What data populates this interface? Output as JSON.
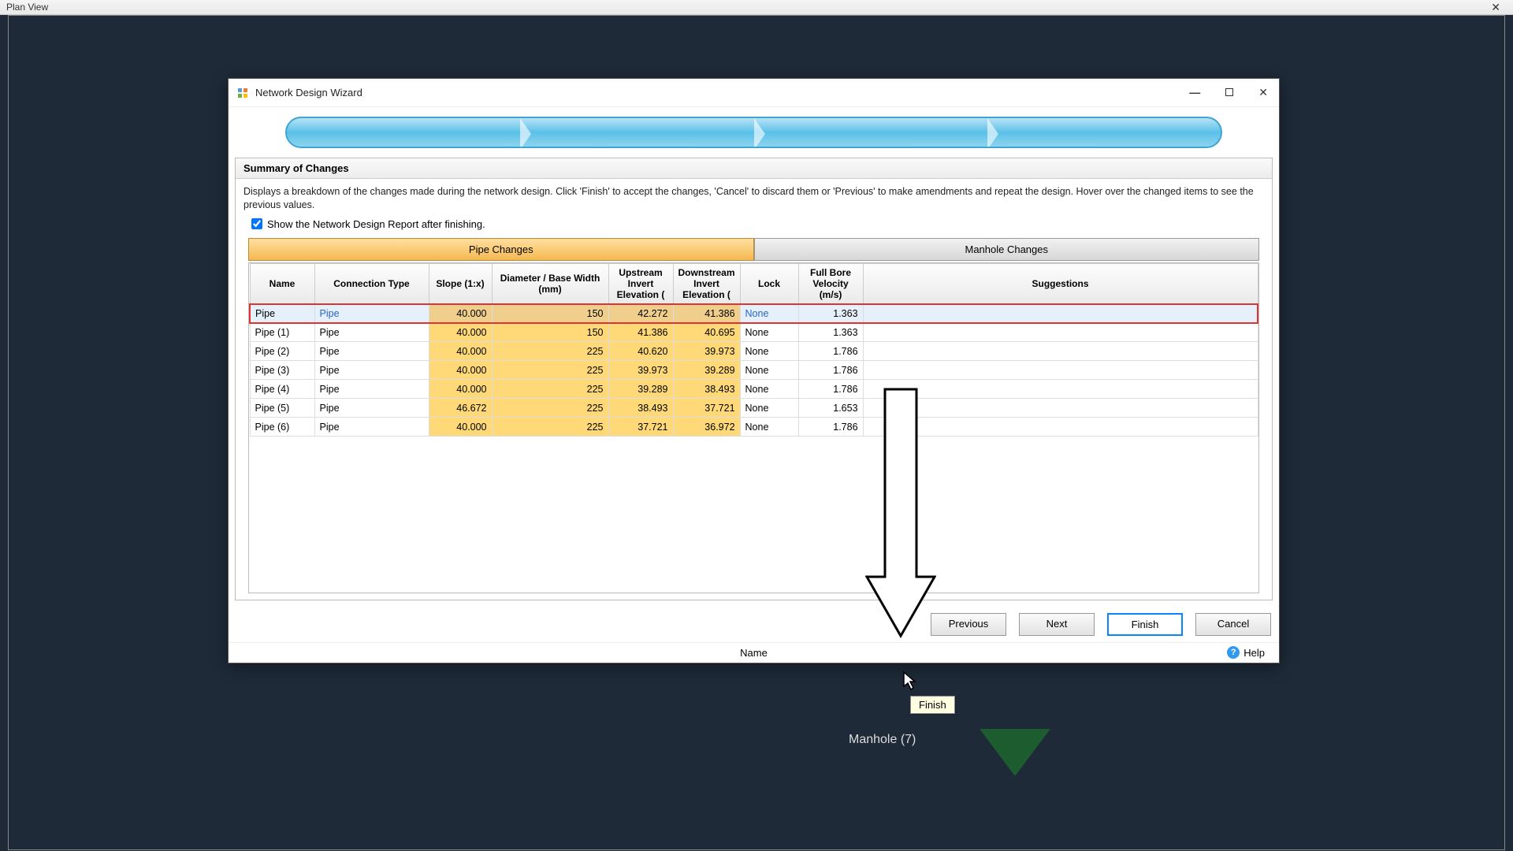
{
  "outer_window": {
    "title": "Plan View"
  },
  "dialog": {
    "title": "Network Design Wizard",
    "section_title": "Summary of Changes",
    "description": "Displays a breakdown of the changes made during the network design. Click 'Finish' to accept the changes, 'Cancel' to discard them or 'Previous' to make amendments and repeat the design. Hover over the changed items to see the previous values.",
    "checkbox_label": "Show the Network Design Report after finishing.",
    "checkbox_checked": true,
    "tabs": {
      "pipe": "Pipe Changes",
      "manhole": "Manhole Changes"
    },
    "headers": {
      "name": "Name",
      "conn": "Connection Type",
      "slope": "Slope (1:x)",
      "diam": "Diameter / Base Width (mm)",
      "up": "Upstream Invert Elevation (",
      "down": "Downstream Invert Elevation (",
      "lock": "Lock",
      "vel": "Full Bore Velocity (m/s)",
      "sugg": "Suggestions"
    },
    "rows": [
      {
        "name": "Pipe",
        "conn": "Pipe",
        "slope": "40.000",
        "diam": "150",
        "up": "42.272",
        "down": "41.386",
        "lock": "None",
        "vel": "1.363",
        "selected": true
      },
      {
        "name": "Pipe (1)",
        "conn": "Pipe",
        "slope": "40.000",
        "diam": "150",
        "up": "41.386",
        "down": "40.695",
        "lock": "None",
        "vel": "1.363"
      },
      {
        "name": "Pipe (2)",
        "conn": "Pipe",
        "slope": "40.000",
        "diam": "225",
        "up": "40.620",
        "down": "39.973",
        "lock": "None",
        "vel": "1.786"
      },
      {
        "name": "Pipe (3)",
        "conn": "Pipe",
        "slope": "40.000",
        "diam": "225",
        "up": "39.973",
        "down": "39.289",
        "lock": "None",
        "vel": "1.786"
      },
      {
        "name": "Pipe (4)",
        "conn": "Pipe",
        "slope": "40.000",
        "diam": "225",
        "up": "39.289",
        "down": "38.493",
        "lock": "None",
        "vel": "1.786"
      },
      {
        "name": "Pipe (5)",
        "conn": "Pipe",
        "slope": "46.672",
        "diam": "225",
        "up": "38.493",
        "down": "37.721",
        "lock": "None",
        "vel": "1.653"
      },
      {
        "name": "Pipe (6)",
        "conn": "Pipe",
        "slope": "40.000",
        "diam": "225",
        "up": "37.721",
        "down": "36.972",
        "lock": "None",
        "vel": "1.786"
      }
    ],
    "buttons": {
      "previous": "Previous",
      "next": "Next",
      "finish": "Finish",
      "cancel": "Cancel"
    },
    "footer": {
      "name_label": "Name",
      "help_label": "Help"
    },
    "tooltip": "Finish"
  },
  "background": {
    "manhole_label": "Manhole (7)"
  }
}
